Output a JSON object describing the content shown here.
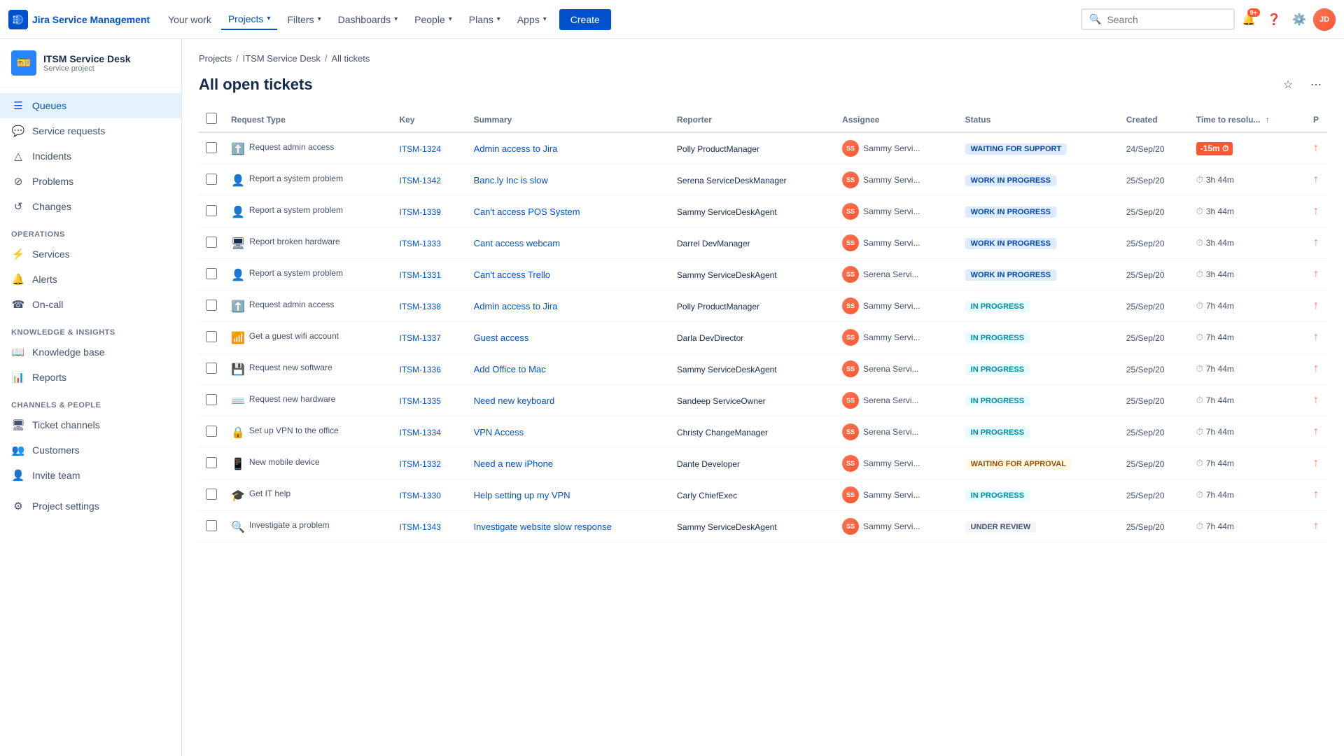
{
  "app": {
    "name": "Jira Service Management",
    "logo_text": "Jira Service Management"
  },
  "topnav": {
    "items": [
      {
        "label": "Your work",
        "active": false
      },
      {
        "label": "Projects",
        "active": true,
        "has_chevron": true
      },
      {
        "label": "Filters",
        "active": false,
        "has_chevron": true
      },
      {
        "label": "Dashboards",
        "active": false,
        "has_chevron": true
      },
      {
        "label": "People",
        "active": false,
        "has_chevron": true
      },
      {
        "label": "Plans",
        "active": false,
        "has_chevron": true
      },
      {
        "label": "Apps",
        "active": false,
        "has_chevron": true
      }
    ],
    "create_label": "Create",
    "search_placeholder": "Search",
    "notification_count": "9+"
  },
  "sidebar": {
    "project_name": "ITSM Service Desk",
    "project_type": "Service project",
    "nav_items": [
      {
        "label": "Queues",
        "icon": "☰",
        "active": true
      },
      {
        "label": "Service requests",
        "icon": "💬",
        "active": false
      },
      {
        "label": "Incidents",
        "icon": "△",
        "active": false
      },
      {
        "label": "Problems",
        "icon": "⊘",
        "active": false
      },
      {
        "label": "Changes",
        "icon": "↺",
        "active": false
      }
    ],
    "sections": [
      {
        "label": "OPERATIONS",
        "items": [
          {
            "label": "Services",
            "icon": "⚡"
          },
          {
            "label": "Alerts",
            "icon": "🔔"
          },
          {
            "label": "On-call",
            "icon": "☎"
          }
        ]
      },
      {
        "label": "KNOWLEDGE & INSIGHTS",
        "items": [
          {
            "label": "Knowledge base",
            "icon": "📖"
          },
          {
            "label": "Reports",
            "icon": "📊"
          }
        ]
      },
      {
        "label": "CHANNELS & PEOPLE",
        "items": [
          {
            "label": "Ticket channels",
            "icon": "🖥"
          },
          {
            "label": "Customers",
            "icon": "👥"
          },
          {
            "label": "Invite team",
            "icon": "👤"
          }
        ]
      }
    ],
    "bottom_items": [
      {
        "label": "Project settings",
        "icon": "⚙"
      }
    ]
  },
  "breadcrumb": {
    "items": [
      "Projects",
      "ITSM Service Desk",
      "All tickets"
    ]
  },
  "page": {
    "title": "All open tickets"
  },
  "table": {
    "columns": [
      "Request Type",
      "Key",
      "Summary",
      "Reporter",
      "Assignee",
      "Status",
      "Created",
      "Time to resolu...",
      "P"
    ],
    "rows": [
      {
        "req_icon": "⬆️",
        "req_label": "Request admin access",
        "key": "ITSM-1324",
        "summary": "Admin access to Jira",
        "reporter": "Polly ProductManager",
        "assignee": "Sammy Servi...",
        "status": "WAITING FOR SUPPORT",
        "status_type": "waiting_support",
        "created": "24/Sep/20",
        "time": "-15m",
        "time_type": "overdue",
        "priority": "↑"
      },
      {
        "req_icon": "👤",
        "req_label": "Report a system problem",
        "key": "ITSM-1342",
        "summary": "Banc.ly Inc is slow",
        "reporter": "Serena ServiceDeskManager",
        "assignee": "Sammy Servi...",
        "status": "WORK IN PROGRESS",
        "status_type": "wip",
        "created": "25/Sep/20",
        "time": "3h 44m",
        "time_type": "normal",
        "priority": "↑"
      },
      {
        "req_icon": "👤",
        "req_label": "Report a system problem",
        "key": "ITSM-1339",
        "summary": "Can't access POS System",
        "reporter": "Sammy ServiceDeskAgent",
        "assignee": "Sammy Servi...",
        "status": "WORK IN PROGRESS",
        "status_type": "wip",
        "created": "25/Sep/20",
        "time": "3h 44m",
        "time_type": "normal",
        "priority": "↑"
      },
      {
        "req_icon": "🖥",
        "req_label": "Report broken hardware",
        "key": "ITSM-1333",
        "summary": "Cant access webcam",
        "reporter": "Darrel DevManager",
        "assignee": "Sammy Servi...",
        "status": "WORK IN PROGRESS",
        "status_type": "wip",
        "created": "25/Sep/20",
        "time": "3h 44m",
        "time_type": "normal",
        "priority": "↑"
      },
      {
        "req_icon": "👤",
        "req_label": "Report a system problem",
        "key": "ITSM-1331",
        "summary": "Can't access Trello",
        "reporter": "Sammy ServiceDeskAgent",
        "assignee": "Serena Servi...",
        "status": "WORK IN PROGRESS",
        "status_type": "wip",
        "created": "25/Sep/20",
        "time": "3h 44m",
        "time_type": "normal",
        "priority": "↑"
      },
      {
        "req_icon": "⬆️",
        "req_label": "Request admin access",
        "key": "ITSM-1338",
        "summary": "Admin access to Jira",
        "reporter": "Polly ProductManager",
        "assignee": "Sammy Servi...",
        "status": "IN PROGRESS",
        "status_type": "inprogress",
        "created": "25/Sep/20",
        "time": "7h 44m",
        "time_type": "normal",
        "priority": "↑"
      },
      {
        "req_icon": "📶",
        "req_label": "Get a guest wifi account",
        "key": "ITSM-1337",
        "summary": "Guest access",
        "reporter": "Darla DevDirector",
        "assignee": "Sammy Servi...",
        "status": "IN PROGRESS",
        "status_type": "inprogress",
        "created": "25/Sep/20",
        "time": "7h 44m",
        "time_type": "normal",
        "priority": "↑"
      },
      {
        "req_icon": "💾",
        "req_label": "Request new software",
        "key": "ITSM-1336",
        "summary": "Add Office to Mac",
        "reporter": "Sammy ServiceDeskAgent",
        "assignee": "Serena Servi...",
        "status": "IN PROGRESS",
        "status_type": "inprogress",
        "created": "25/Sep/20",
        "time": "7h 44m",
        "time_type": "normal",
        "priority": "↑"
      },
      {
        "req_icon": "⌨️",
        "req_label": "Request new hardware",
        "key": "ITSM-1335",
        "summary": "Need new keyboard",
        "reporter": "Sandeep ServiceOwner",
        "assignee": "Serena Servi...",
        "status": "IN PROGRESS",
        "status_type": "inprogress",
        "created": "25/Sep/20",
        "time": "7h 44m",
        "time_type": "normal",
        "priority": "↑"
      },
      {
        "req_icon": "🔒",
        "req_label": "Set up VPN to the office",
        "key": "ITSM-1334",
        "summary": "VPN Access",
        "reporter": "Christy ChangeManager",
        "assignee": "Serena Servi...",
        "status": "IN PROGRESS",
        "status_type": "inprogress",
        "created": "25/Sep/20",
        "time": "7h 44m",
        "time_type": "normal",
        "priority": "↑"
      },
      {
        "req_icon": "📱",
        "req_label": "New mobile device",
        "key": "ITSM-1332",
        "summary": "Need a new iPhone",
        "reporter": "Dante Developer",
        "assignee": "Sammy Servi...",
        "status": "WAITING FOR APPROVAL",
        "status_type": "approval",
        "created": "25/Sep/20",
        "time": "7h 44m",
        "time_type": "normal",
        "priority": "↑"
      },
      {
        "req_icon": "🎓",
        "req_label": "Get IT help",
        "key": "ITSM-1330",
        "summary": "Help setting up my VPN",
        "reporter": "Carly ChiefExec",
        "assignee": "Sammy Servi...",
        "status": "IN PROGRESS",
        "status_type": "inprogress",
        "created": "25/Sep/20",
        "time": "7h 44m",
        "time_type": "normal",
        "priority": "↑"
      },
      {
        "req_icon": "🔍",
        "req_label": "Investigate a problem",
        "key": "ITSM-1343",
        "summary": "Investigate website slow response",
        "reporter": "Sammy ServiceDeskAgent",
        "assignee": "Sammy Servi...",
        "status": "UNDER REVIEW",
        "status_type": "review",
        "created": "25/Sep/20",
        "time": "7h 44m",
        "time_type": "normal",
        "priority": "↑"
      }
    ]
  }
}
